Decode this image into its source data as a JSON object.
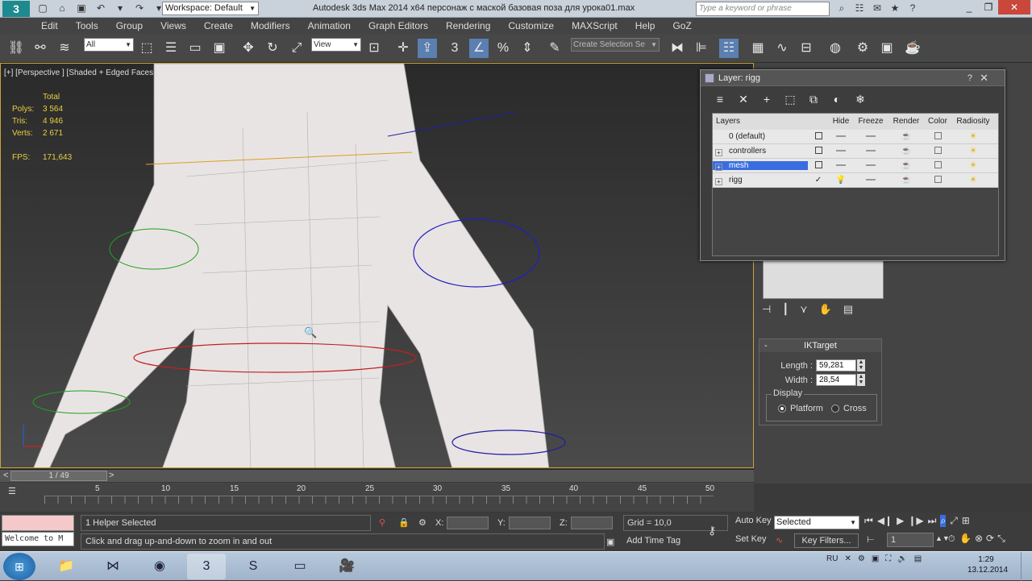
{
  "titlebar": {
    "workspace": "Workspace: Default",
    "window_title": "Autodesk 3ds Max  2014 x64      персонаж с маской базовая поза для урока01.max",
    "search_placeholder": "Type a keyword or phrase",
    "help": "?"
  },
  "menu": [
    "Edit",
    "Tools",
    "Group",
    "Views",
    "Create",
    "Modifiers",
    "Animation",
    "Graph Editors",
    "Rendering",
    "Customize",
    "MAXScript",
    "Help",
    "GoZ"
  ],
  "toolbar": {
    "filter": "All",
    "refcoord": "View",
    "snap": "3",
    "selection_set_placeholder": "Create Selection Se"
  },
  "viewport": {
    "label": "[+] [Perspective ] [Shaded + Edged Faces ]",
    "stats_total": "Total",
    "stats": [
      {
        "k": "Polys:",
        "v": "3 564"
      },
      {
        "k": "Tris:",
        "v": "4 946"
      },
      {
        "k": "Verts:",
        "v": "2 671"
      }
    ],
    "fps_label": "FPS:",
    "fps_value": "171,643"
  },
  "layer_window": {
    "title": "Layer: rigg",
    "help": "?",
    "close": "✕",
    "columns": [
      "Layers",
      "Hide",
      "Freeze",
      "Render",
      "Color",
      "Radiosity"
    ],
    "rows": [
      {
        "name": "0 (default)",
        "expand": "",
        "current": false
      },
      {
        "name": "controllers",
        "expand": "+",
        "current": false
      },
      {
        "name": "mesh",
        "expand": "+",
        "current": false,
        "selected": true
      },
      {
        "name": "rigg",
        "expand": "+",
        "current": true
      }
    ]
  },
  "ik_target": {
    "title": "IKTarget",
    "collapse": "-",
    "length_label": "Length :",
    "length_value": "59,281",
    "width_label": "Width :",
    "width_value": "28,54",
    "display_label": "Display",
    "platform_label": "Platform",
    "cross_label": "Cross"
  },
  "timeline": {
    "frame_display": "1 / 49",
    "prev": "<",
    "next": ">",
    "ticks": [
      "5",
      "10",
      "15",
      "20",
      "25",
      "30",
      "35",
      "40",
      "45",
      "50"
    ]
  },
  "status": {
    "maxscript": "Welcome to M",
    "selection": "1 Helper Selected",
    "prompt": "Click and drag up-and-down to zoom in and out",
    "x_label": "X:",
    "y_label": "Y:",
    "z_label": "Z:",
    "grid": "Grid = 10,0",
    "add_time_tag": "Add Time Tag",
    "auto_key": "Auto Key",
    "set_key": "Set Key",
    "key_selected": "Selected",
    "key_filters": "Key Filters...",
    "current_frame": "1"
  },
  "taskbar": {
    "lang": "RU",
    "time": "1:29",
    "date": "13.12.2014"
  }
}
